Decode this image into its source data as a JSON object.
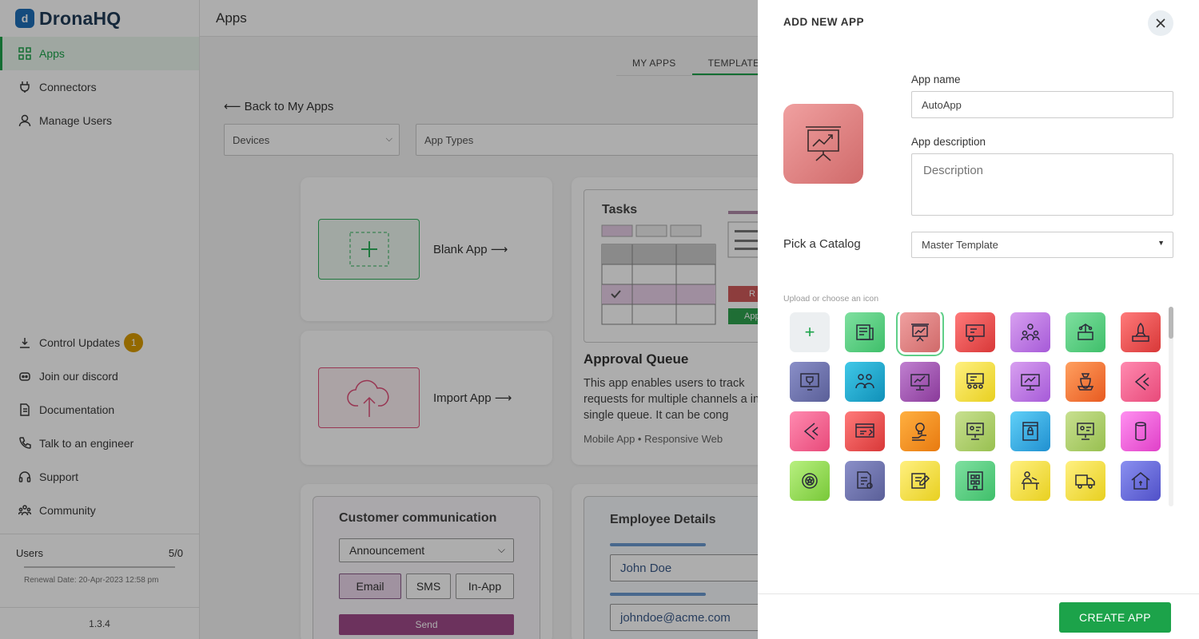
{
  "sidebar": {
    "brand": "DronaHQ",
    "nav": [
      {
        "label": "Apps",
        "icon": "apps-grid-icon"
      },
      {
        "label": "Connectors",
        "icon": "plug-icon"
      },
      {
        "label": "Manage Users",
        "icon": "user-icon"
      }
    ],
    "bottom_nav": [
      {
        "label": "Control Updates",
        "icon": "download-icon",
        "badge": "1"
      },
      {
        "label": "Join our discord",
        "icon": "discord-icon"
      },
      {
        "label": "Documentation",
        "icon": "document-icon"
      },
      {
        "label": "Talk to an engineer",
        "icon": "phone-icon"
      },
      {
        "label": "Support",
        "icon": "headset-icon"
      },
      {
        "label": "Community",
        "icon": "community-icon"
      }
    ],
    "users_label": "Users",
    "users_count": "5/0",
    "renewal": "Renewal Date: 20-Apr-2023 12:58 pm",
    "version": "1.3.4"
  },
  "main": {
    "title": "Apps",
    "tabs": [
      {
        "label": "MY APPS"
      },
      {
        "label": "TEMPLATE"
      }
    ],
    "back_link": "⟵  Back to My Apps",
    "filters": {
      "devices": "Devices",
      "app_types": "App Types"
    },
    "blank_app": "Blank App  ⟶",
    "import_app": "Import App  ⟶",
    "tasks_card": {
      "title": "Tasks",
      "name": "Approval Queue",
      "desc": "This app enables users to track requests for multiple channels a in a single queue. It can be cong",
      "meta": "Mobile App • Responsive Web",
      "btn_r": "R",
      "btn_app": "App"
    },
    "comm_card": {
      "title": "Customer communication",
      "select": "Announcement",
      "pills": [
        "Email",
        "SMS",
        "In-App"
      ],
      "send": "Send"
    },
    "emp_card": {
      "title": "Employee Details",
      "name": "John Doe",
      "email": "johndoe@acme.com"
    }
  },
  "drawer": {
    "title": "ADD NEW APP",
    "app_name_label": "App name",
    "app_name_value": "AutoApp",
    "app_desc_label": "App description",
    "app_desc_placeholder": "Description",
    "catalog_label": "Pick a Catalog",
    "catalog_value": "Master Template",
    "icons_hint": "Upload or choose an icon",
    "create_button": "CREATE APP",
    "selected_color": "#d97a7a",
    "icons": [
      {
        "name": "add-icon",
        "bg": "#eceff1"
      },
      {
        "name": "newspaper-icon",
        "bg": "linear-gradient(135deg,#7fe0a0,#3fbf6a)"
      },
      {
        "name": "presentation-chart-icon",
        "bg": "linear-gradient(135deg,#f0a0a0,#d06a6a)"
      },
      {
        "name": "board-settings-icon",
        "bg": "linear-gradient(135deg,#ff7a7a,#d83838)"
      },
      {
        "name": "team-gear-icon",
        "bg": "linear-gradient(135deg,#d8a0f0,#a65ad8)"
      },
      {
        "name": "network-monitor-icon",
        "bg": "linear-gradient(135deg,#7fe0a0,#3fbf6a)"
      },
      {
        "name": "rocket-box-icon",
        "bg": "linear-gradient(135deg,#ff7a7a,#d83838)"
      },
      {
        "name": "trophy-board-icon",
        "bg": "linear-gradient(135deg,#8a8fc8,#5a5f98)"
      },
      {
        "name": "team-icon",
        "bg": "linear-gradient(135deg,#40c8e8,#1090b8)"
      },
      {
        "name": "monitor-chart-icon",
        "bg": "linear-gradient(135deg,#c080d0,#8a3a9a)"
      },
      {
        "name": "meeting-board-icon",
        "bg": "linear-gradient(135deg,#fff080,#e8d020)"
      },
      {
        "name": "monitor-growth-icon",
        "bg": "linear-gradient(135deg,#d8a0f0,#a65ad8)"
      },
      {
        "name": "money-cart-icon",
        "bg": "linear-gradient(135deg,#ffa060,#e85a20)"
      },
      {
        "name": "brand-c-icon",
        "bg": "linear-gradient(135deg,#ff8ab0,#e84a7a)"
      },
      {
        "name": "brand-c-alt-icon",
        "bg": "linear-gradient(135deg,#ff8ab0,#e84a7a)"
      },
      {
        "name": "window-edit-icon",
        "bg": "linear-gradient(135deg,#ff7a7a,#d83838)"
      },
      {
        "name": "idea-hand-icon",
        "bg": "linear-gradient(135deg,#ffb040,#e87a10)"
      },
      {
        "name": "presenter-icon",
        "bg": "linear-gradient(135deg,#c8e090,#98c050)"
      },
      {
        "name": "secure-board-icon",
        "bg": "linear-gradient(135deg,#60d0f8,#2090d0)"
      },
      {
        "name": "presenter-alt-icon",
        "bg": "linear-gradient(135deg,#c8e090,#98c050)"
      },
      {
        "name": "cylinder-icon",
        "bg": "linear-gradient(135deg,#ff90f0,#e040c8)"
      },
      {
        "name": "award-icon",
        "bg": "linear-gradient(135deg,#b8f080,#78c838)"
      },
      {
        "name": "document-badge-icon",
        "bg": "linear-gradient(135deg,#8a8fc8,#5a5f98)"
      },
      {
        "name": "note-edit-icon",
        "bg": "linear-gradient(135deg,#fff080,#e8d020)"
      },
      {
        "name": "building-icon",
        "bg": "linear-gradient(135deg,#7fe0a0,#3fbf6a)"
      },
      {
        "name": "desk-worker-icon",
        "bg": "linear-gradient(135deg,#fff080,#e8d020)"
      },
      {
        "name": "delivery-truck-icon",
        "bg": "linear-gradient(135deg,#fff080,#e8d020)"
      },
      {
        "name": "home-finance-icon",
        "bg": "linear-gradient(135deg,#8a90f0,#5050c8)"
      }
    ]
  }
}
